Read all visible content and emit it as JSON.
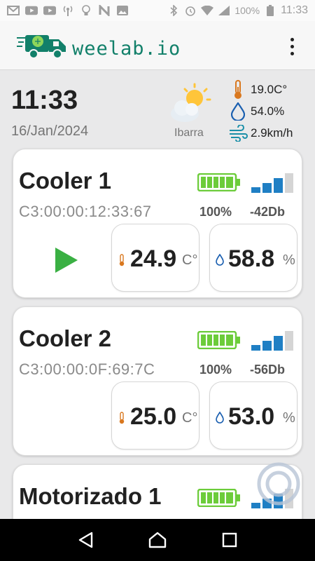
{
  "status_bar": {
    "battery_text": "100%",
    "time": "11:33"
  },
  "app": {
    "brand": "weelab.io",
    "brand_color": "#12806a"
  },
  "header": {
    "time": "11:33",
    "date": "16/Jan/2024",
    "city": "Ibarra",
    "temperature": "19.0C°",
    "humidity": "54.0%",
    "wind": "2.9km/h"
  },
  "devices": [
    {
      "name": "Cooler 1",
      "mac": "C3:00:00:12:33:67",
      "battery": "100%",
      "battery_level": 1.0,
      "rssi": "-42Db",
      "signal_bars": 3,
      "temperature": "24.9",
      "temperature_unit": "C°",
      "humidity": "58.8",
      "humidity_unit": "%",
      "has_play": true
    },
    {
      "name": "Cooler 2",
      "mac": "C3:00:00:0F:69:7C",
      "battery": "100%",
      "battery_level": 1.0,
      "rssi": "-56Db",
      "signal_bars": 3,
      "temperature": "25.0",
      "temperature_unit": "C°",
      "humidity": "53.0",
      "humidity_unit": "%",
      "has_play": false
    },
    {
      "name": "Motorizado 1",
      "battery_level": 1.0,
      "signal_bars": 3
    }
  ],
  "colors": {
    "battery_green": "#6ccc3a",
    "signal_blue": "#1f7fc4",
    "play_green": "#3ab043"
  }
}
